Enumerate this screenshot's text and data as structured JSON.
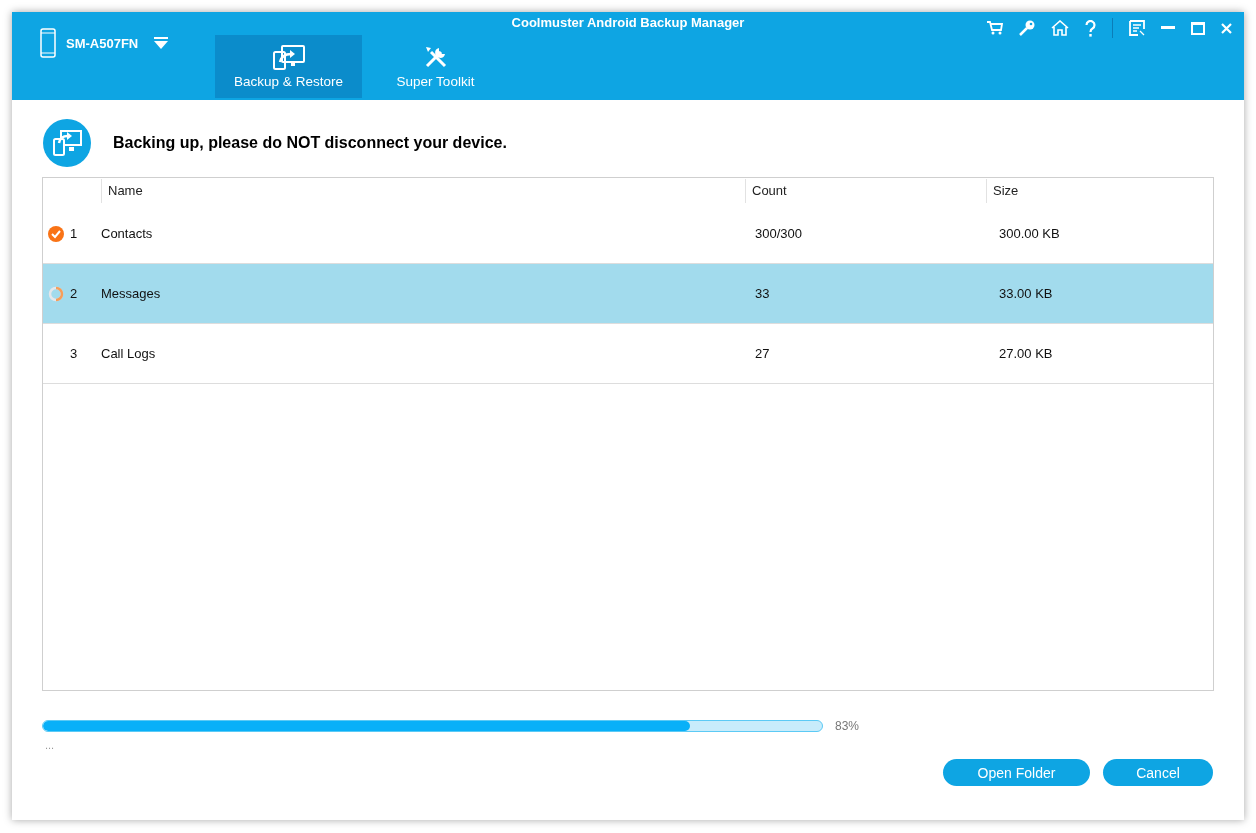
{
  "window": {
    "title": "Coolmuster Android Backup Manager"
  },
  "device": {
    "name": "SM-A507FN"
  },
  "tabs": [
    {
      "label": "Backup & Restore",
      "kind": "backup",
      "selected": true
    },
    {
      "label": "Super Toolkit",
      "kind": "toolkit",
      "selected": false
    }
  ],
  "message": "Backing up, please do NOT disconnect your device.",
  "table": {
    "columns": [
      "Name",
      "Count",
      "Size"
    ],
    "rows": [
      {
        "index": "1",
        "name": "Contacts",
        "count": "300/300",
        "size": "300.00 KB",
        "completed": true,
        "in_progress": false,
        "selected": false
      },
      {
        "index": "2",
        "name": "Messages",
        "count": "33",
        "size": "33.00 KB",
        "completed": false,
        "in_progress": true,
        "selected": true
      },
      {
        "index": "3",
        "name": "Call Logs",
        "count": "27",
        "size": "27.00 KB",
        "completed": false,
        "in_progress": false,
        "selected": false
      }
    ]
  },
  "progress": {
    "level": 0.83,
    "reading": "83%",
    "status_text": "..."
  },
  "buttons": [
    "Open Folder",
    "Cancel"
  ]
}
